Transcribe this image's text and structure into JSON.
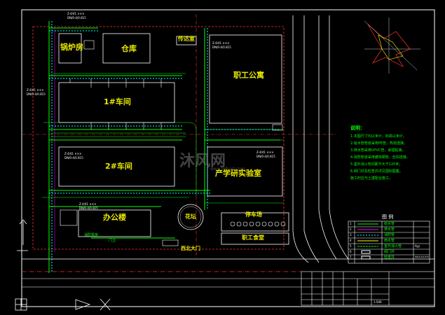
{
  "buildings": {
    "boiler": "锅炉房",
    "warehouse": "仓库",
    "gatehouse": "传达室",
    "staff_apartment": "职工公寓",
    "workshop1": "1#车间",
    "workshop2": "2#车间",
    "research": "产学研实验室",
    "office": "办公楼",
    "fountain": "花坛",
    "parking_area": "停车场",
    "staff_canteen": "职工食堂",
    "gate": "西北大门"
  },
  "small_labels": {
    "pipe1": "Z-4/41 ✕✕✕",
    "pipe1b": "DN/0-4/0.815",
    "pipe2": "Z-4/41 ✕✕✕",
    "pipe2b": "DN/0-4/0.815",
    "pipe3": "Z-4/41 ✕✕✕",
    "pipe3b": "DN/0-4/0.815",
    "pipe4": "Z-4/41 ✕✕✕",
    "pipe4b": "DN/0-4/0.815",
    "pipe5": "Z-4/41 ✕✕✕",
    "pipe5b": "DN/0-4/0.815",
    "pipe6": "Z-4/41 ✕✕✕",
    "pipe6b": "DN/0-4/0.815",
    "south_a": "消防泵房",
    "south_b": "门卫"
  },
  "notes": {
    "heading": "说明：",
    "lines": [
      "1.本图尺寸均以米计，标高以米计。",
      "2.给水管管道采用PE管，热熔连接。",
      "3.排水管采用UPVC管，承插粘接。",
      "4.消防管道采用镀锌钢管，丝扣连接。",
      "5.室外消火栓间距不大于120米，",
      "6.阀门井及检查井详见国标图集，",
      "  施工时应与土建配合施工。"
    ]
  },
  "legend": {
    "title": "图 例",
    "rows": [
      {
        "n": "1",
        "desc": "给水管"
      },
      {
        "n": "2",
        "desc": "排水管"
      },
      {
        "n": "3",
        "desc": "消防管"
      },
      {
        "n": "4",
        "desc": "雨水管"
      },
      {
        "n": "5",
        "desc": "室外消火栓",
        "extra": "Ayy"
      },
      {
        "n": "6",
        "desc": "阀门井"
      },
      {
        "n": "7",
        "desc": "检查井",
        "extra": "DN/0-4/0.815"
      }
    ]
  },
  "title_block": {
    "cells": [
      "",
      "",
      "",
      "",
      "",
      "",
      "",
      "",
      "",
      ""
    ],
    "scale": "1:500"
  },
  "watermark": {
    "text": "沐风网",
    "url": "www.mfcad.com"
  },
  "colors": {
    "wall": "#ff3030",
    "building": "#ffffff",
    "pipe_green": "#00ff00",
    "pipe_cyan": "#00ffff",
    "road": "#ffffff",
    "text": "#e8e800"
  }
}
